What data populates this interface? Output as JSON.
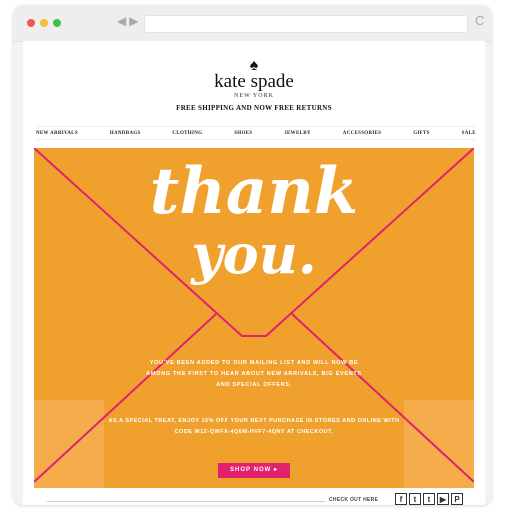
{
  "browser": {
    "dot_colors": [
      "#ee5a52",
      "#f5be3a",
      "#3cc04f"
    ],
    "back_glyph": "◀",
    "forward_glyph": "▶",
    "reload_glyph": "C"
  },
  "header": {
    "logo_icon": "spade-icon",
    "logo_glyph": "♠",
    "brand": "kate spade",
    "subbrand": "NEW YORK",
    "promo": "FREE SHIPPING AND NOW FREE RETURNS"
  },
  "nav": {
    "items": [
      "NEW ARRIVALS",
      "HANDBAGS",
      "CLOTHING",
      "SHOES",
      "JEWELRY",
      "ACCESSORIES",
      "GIFTS",
      "SALE"
    ]
  },
  "hero": {
    "bg_color": "#f0a02c",
    "line_color": "#e2206e",
    "headline_1": "thank",
    "headline_2": "you.",
    "message": "YOU'VE BEEN ADDED TO OUR MAILING LIST AND WILL NOW BE AMONG THE FIRST TO HEAR ABOUT NEW ARRIVALS, BIG EVENTS AND SPECIAL OFFERS.",
    "offer": "AS A SPECIAL TREAT, ENJOY 15% OFF YOUR NEXT PURCHASE IN-STORES AND ONLINE WITH CODE W12-QWFX-4Q6M-HVF7-4QNY AT CHECKOUT.",
    "cta": "SHOP NOW ▸"
  },
  "footer": {
    "checkout_label": "CHECK OUT HERE",
    "social": [
      {
        "icon": "facebook-icon",
        "glyph": "f"
      },
      {
        "icon": "tumblr-icon",
        "glyph": "t"
      },
      {
        "icon": "twitter-icon",
        "glyph": "t"
      },
      {
        "icon": "youtube-icon",
        "glyph": "▶"
      },
      {
        "icon": "pinterest-icon",
        "glyph": "P"
      }
    ]
  }
}
